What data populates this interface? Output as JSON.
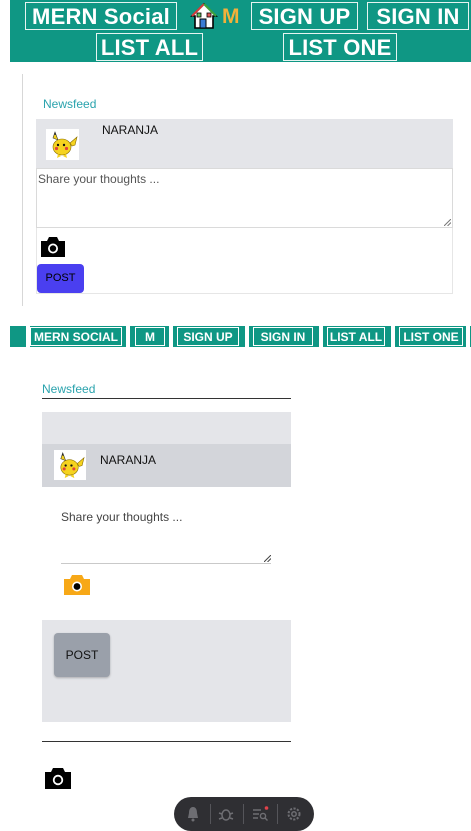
{
  "nav_top": {
    "brand": "MERN Social",
    "home_icon": "home-icon",
    "home_letter": "M",
    "signup": "SIGN UP",
    "signin": "SIGN IN",
    "list_all": "LIST ALL",
    "list_one": "LIST ONE"
  },
  "feed1": {
    "title": "Newsfeed",
    "user": "NARANJA",
    "placeholder": "Share your thoughts ...",
    "camera_icon": "camera-icon",
    "post": "POST"
  },
  "nav_second": {
    "brand": "MERN SOCIAL",
    "home": "M",
    "signup": "SIGN UP",
    "signin": "SIGN IN",
    "list_all": "LIST ALL",
    "list_one": "LIST ONE"
  },
  "feed2": {
    "title": "Newsfeed",
    "user": "NARANJA",
    "placeholder": "Share your thoughts ...",
    "camera_icon": "camera-icon",
    "post": "POST",
    "bottom_camera_icon": "camera-icon"
  },
  "toolbar": {
    "icons": [
      "bell-icon",
      "bug-icon",
      "search-list-icon",
      "settings-icon"
    ]
  },
  "colors": {
    "nav": "#0f9784",
    "post_button": "#4a3ff0",
    "camera_accent": "#f7a817",
    "link": "#2aa3ad"
  }
}
